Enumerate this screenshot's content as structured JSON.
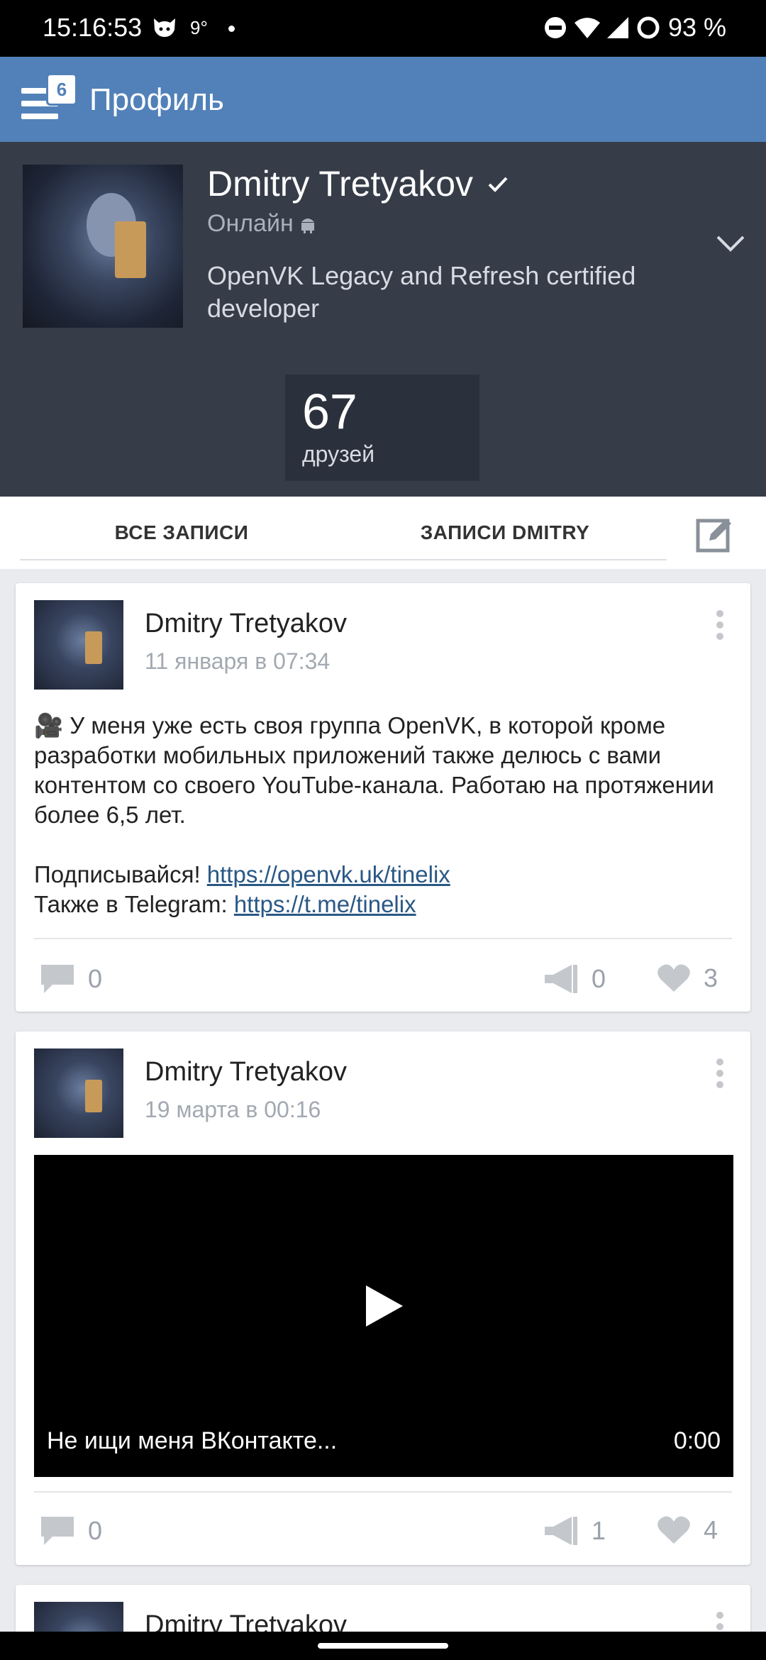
{
  "status_bar": {
    "time": "15:16:53",
    "temperature": "9°",
    "battery": "93 %"
  },
  "toolbar": {
    "title": "Профиль",
    "menu_badge": "6"
  },
  "profile": {
    "name": "Dmitry Tretyakov",
    "online": "Онлайн",
    "status": "OpenVK Legacy and Refresh certified developer",
    "friends_count": "67",
    "friends_label": "друзей"
  },
  "tabs": [
    {
      "label": "ВСЕ ЗАПИСИ"
    },
    {
      "label": "ЗАПИСИ DMITRY"
    }
  ],
  "posts": [
    {
      "author": "Dmitry Tretyakov",
      "date": "11 января в 07:34",
      "text_line1": "🎥 У меня уже есть своя группа OpenVK, в которой кроме разработки мобильных приложений также делюсь с вами контентом со своего YouTube-канала. Работаю на протяжении более 6,5 лет.",
      "subscribe_label": "Подписывайся!",
      "subscribe_link": "https://openvk.uk/tinelix",
      "telegram_label": "Также в Telegram:",
      "telegram_link": "https://t.me/tinelix",
      "comments": "0",
      "reposts": "0",
      "likes": "3"
    },
    {
      "author": "Dmitry Tretyakov",
      "date": "19 марта в 00:16",
      "video_title": "Не ищи меня ВКонтакте...",
      "video_duration": "0:00",
      "comments": "0",
      "reposts": "1",
      "likes": "4"
    },
    {
      "author": "Dmitry Tretyakov"
    }
  ],
  "colors": {
    "toolbar": "#5181b8",
    "header": "#363d49",
    "link": "#2a5885"
  }
}
